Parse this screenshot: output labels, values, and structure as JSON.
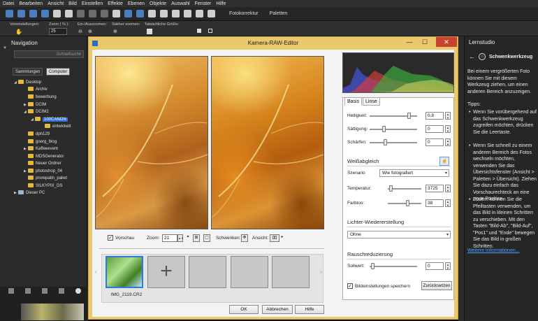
{
  "menu": [
    "Datei",
    "Bearbeiten",
    "Ansicht",
    "Bild",
    "Einstellen",
    "Effekte",
    "Ebenen",
    "Objekte",
    "Auswahl",
    "Fenster",
    "Hilfe"
  ],
  "toolbar": {
    "fotokorrektur": "Fotokorrektur",
    "paletten": "Paletten"
  },
  "optbar": {
    "vorein": "Voreinstellungen:",
    "zoom_lbl": "Zoom ( % ):",
    "zoom_val": "25",
    "einaus": "Ein-/Auszoomen:",
    "staerker": "Stärker zoomen:",
    "tatsaechlich": "Tatsächliche Größe:"
  },
  "nav": {
    "header": "Navigation",
    "search_placeholder": "Schnellsuche",
    "tabs": [
      "Sammlungen",
      "Computer"
    ],
    "tree": [
      "Desktop",
      "Archiv",
      "bewerbung",
      "DCIM",
      "DCIM2",
      "100CANON",
      "entwickelt",
      "dph129",
      "goerg_blog",
      "Kaffeeevent",
      "MDSGenerator",
      "Neuer Ordner",
      "photoshop_04",
      "prorepatin_paket",
      "SILKYPIX_DS",
      "Dieser PC"
    ]
  },
  "dialog": {
    "title": "Kamera-RAW-Editor",
    "vorschau": "Vorschau",
    "zoom_lbl": "Zoom:",
    "zoom_val": "21",
    "schwenken": "Schwenken:",
    "ansicht": "Ansicht:",
    "thumb_name": "IMG_2119.CR2",
    "ok": "OK",
    "abbrechen": "Abbrechen",
    "hilfe": "Hilfe"
  },
  "settings": {
    "tabs": [
      "Basis",
      "Linse"
    ],
    "helligkeit": {
      "label": "Helligkeit:",
      "value": "0,8"
    },
    "saettigung": {
      "label": "Sättigung:",
      "value": "0"
    },
    "schaerfen": {
      "label": "Schärfen:",
      "value": "0"
    },
    "weissabgleich": "Weißabgleich",
    "szenario_lbl": "Szenario",
    "szenario_val": "Wie fotografiert",
    "temperatur": {
      "label": "Temperatur:",
      "value": "3725"
    },
    "farbton": {
      "label": "Farbton:",
      "value": "38"
    },
    "lichter": "Lichter-Wiedererstellung",
    "lichter_val": "Ohne",
    "rausch": "Rauschreduzierung",
    "sollwert": {
      "label": "Sollwert:",
      "value": "0"
    },
    "speichern": "Bildeinstellungen speichern",
    "zuruecksetzen": "Zurücksetzen"
  },
  "lernstudio": {
    "header": "Lernstudio",
    "title": "Schwenkwerkzeug",
    "intro": "Bei einem vergrößerten Foto können Sie mit diesem Werkzeug ziehen, um einen anderen Bereich anzuzeigen.",
    "tipps": "Tipps:",
    "bullets": [
      "Wenn Sie vorübergehend auf das Schwenkwerkzeug zugreifen möchten, drücken Sie die Leertaste.",
      "Wenn Sie schnell zu einem anderen Bereich des Fotos wechseln möchten, verwenden Sie das Übersichtsfenster (Ansicht > Paletten > Übersicht). Ziehen Sie dazu einfach das Vorschaurechteck an eine neue Position.",
      "Zudem können Sie die Pfeiltasten verwenden, um das Bild in kleinen Schritten zu verschieben. Mit den Tasten \"Bild-Ab\", \"Bild-Auf\", \"Pos1\" und \"Ende\" bewegen Sie das Bild in großen Schritten."
    ],
    "more": "Weitere Informationen..."
  }
}
